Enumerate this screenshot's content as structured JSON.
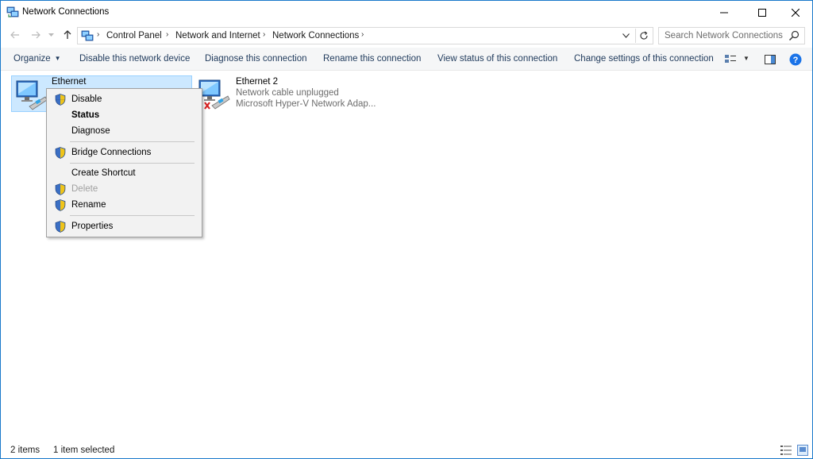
{
  "window": {
    "title": "Network Connections",
    "controls": [
      "minimize-icon",
      "maximize-icon",
      "close-icon"
    ],
    "accent_color": "#1979ca"
  },
  "navigation": {
    "back_icon": "arrow-left-icon",
    "forward_icon": "arrow-right-icon",
    "recent_icon": "chevron-down-icon",
    "up_icon": "arrow-up-icon",
    "breadcrumbs": [
      "Control Panel",
      "Network and Internet",
      "Network Connections"
    ],
    "refresh_icon": "refresh-icon",
    "search_placeholder": "Search Network Connections"
  },
  "toolbar": {
    "organize": "Organize",
    "disable": "Disable this network device",
    "diagnose": "Diagnose this connection",
    "rename": "Rename this connection",
    "view_status": "View status of this connection",
    "change_settings": "Change settings of this connection",
    "view_icons": [
      "change-view-icon",
      "preview-pane-icon",
      "help-icon"
    ]
  },
  "items": [
    {
      "name": "Ethernet",
      "selected": true,
      "details": []
    },
    {
      "name": "Ethernet 2",
      "selected": false,
      "details": [
        "Network cable unplugged",
        "Microsoft Hyper-V Network Adap..."
      ]
    }
  ],
  "context_menu": {
    "items": [
      {
        "label": "Disable",
        "shield": true,
        "bold": false,
        "disabled": false
      },
      {
        "label": "Status",
        "shield": false,
        "bold": true,
        "disabled": false
      },
      {
        "label": "Diagnose",
        "shield": false,
        "bold": false,
        "disabled": false
      },
      {
        "label": "Bridge Connections",
        "shield": true,
        "bold": false,
        "disabled": false
      },
      {
        "label": "Create Shortcut",
        "shield": false,
        "bold": false,
        "disabled": false
      },
      {
        "label": "Delete",
        "shield": true,
        "bold": false,
        "disabled": true
      },
      {
        "label": "Rename",
        "shield": true,
        "bold": false,
        "disabled": false
      },
      {
        "label": "Properties",
        "shield": true,
        "bold": false,
        "disabled": false
      }
    ]
  },
  "statusbar": {
    "item_count": "2 items",
    "selection": "1 item selected",
    "view_icons": [
      "details-view-icon",
      "large-icons-view-icon"
    ]
  },
  "colors": {
    "selection_bg": "#cce8ff",
    "selection_border": "#99d1ff",
    "command_text": "#1e395b",
    "help_blue": "#1a73e8"
  }
}
